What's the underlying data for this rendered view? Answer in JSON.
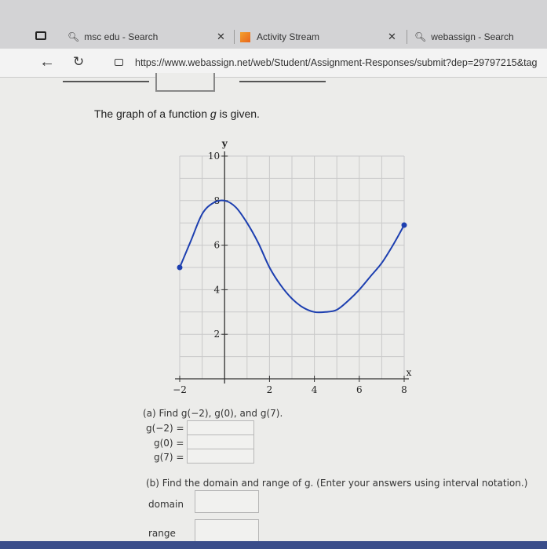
{
  "tabs": [
    {
      "label": "msc edu - Search"
    },
    {
      "label": "Activity Stream"
    },
    {
      "label": "webassign - Search"
    }
  ],
  "address": {
    "url": "https://www.webassign.net/web/Student/Assignment-Responses/submit?dep=29797215&tag"
  },
  "problem": {
    "intro_text": "The graph of a function",
    "fn_name": "g",
    "intro_suffix": "is given.",
    "part_a_prompt": "(a) Find g(−2), g(0), and g(7).",
    "g_neg2_label": "g(−2) =",
    "g_0_label": "g(0) =",
    "g_7_label": "g(7) =",
    "part_b_prompt": "(b) Find the domain and range of g. (Enter your answers using interval notation.)",
    "domain_label": "domain",
    "range_label": "range"
  },
  "chart_data": {
    "type": "line",
    "title": "",
    "xlabel": "x",
    "ylabel": "y",
    "xlim": [
      -2,
      8
    ],
    "ylim": [
      0,
      10
    ],
    "x_ticks": [
      -2,
      2,
      4,
      6,
      8
    ],
    "y_ticks": [
      2,
      4,
      6,
      8,
      10
    ],
    "grid": true,
    "series": [
      {
        "x": [
          -2,
          -1.5,
          -1,
          -0.5,
          0,
          0.5,
          1,
          1.5,
          2,
          2.5,
          3,
          3.5,
          4,
          4.5,
          5,
          5.5,
          6,
          6.5,
          7,
          7.5,
          8
        ],
        "y": [
          5,
          6.2,
          7.4,
          7.9,
          8,
          7.7,
          7,
          6.1,
          5,
          4.2,
          3.6,
          3.2,
          3,
          3,
          3.1,
          3.5,
          4,
          4.6,
          5.2,
          6,
          6.9
        ]
      }
    ],
    "endpoints": [
      {
        "x": -2,
        "y": 5
      },
      {
        "x": 8,
        "y": 6.9
      }
    ]
  },
  "colors": {
    "curve": "#1d3fb0",
    "grid": "#c9c9c9",
    "axis": "#333333"
  }
}
